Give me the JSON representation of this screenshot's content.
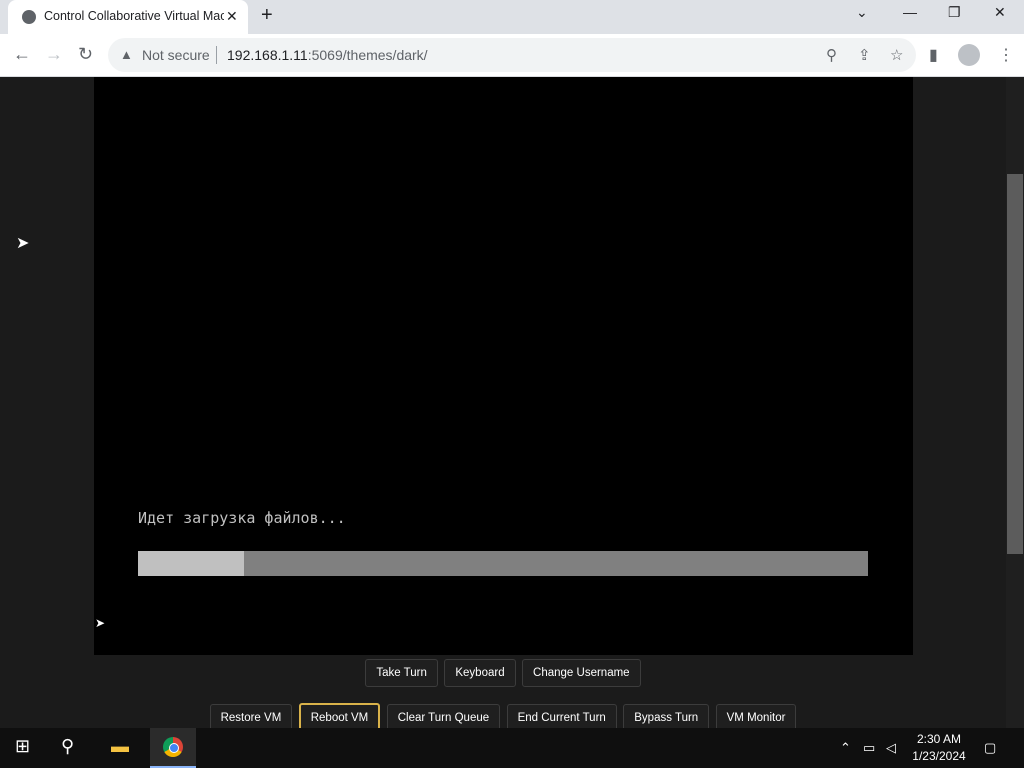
{
  "browser": {
    "tab_title": "Control Collaborative Virtual Mac",
    "tab_close": "✕",
    "new_tab": "+",
    "security_label": "Not secure",
    "url_host": "192.168.1.11",
    "url_rest": ":5069/themes/dark/",
    "window_controls": {
      "tab_search": "⌄",
      "minimize": "—",
      "maximize": "❐",
      "close": "✕"
    }
  },
  "vm": {
    "screen_text": "Идет загрузка файлов...",
    "progress_fraction": 0.145
  },
  "controls": {
    "row1": [
      "Take Turn",
      "Keyboard",
      "Change Username"
    ],
    "row2": [
      "Restore VM",
      "Reboot VM",
      "Clear Turn Queue",
      "End Current Turn",
      "Bypass Turn",
      "VM Monitor"
    ],
    "active_button": "Reboot VM"
  },
  "taskbar": {
    "time": "2:30 AM",
    "date": "1/23/2024"
  },
  "colors": {
    "accent_active_button": "#d9b24a",
    "page_background": "#1b1b1b"
  }
}
